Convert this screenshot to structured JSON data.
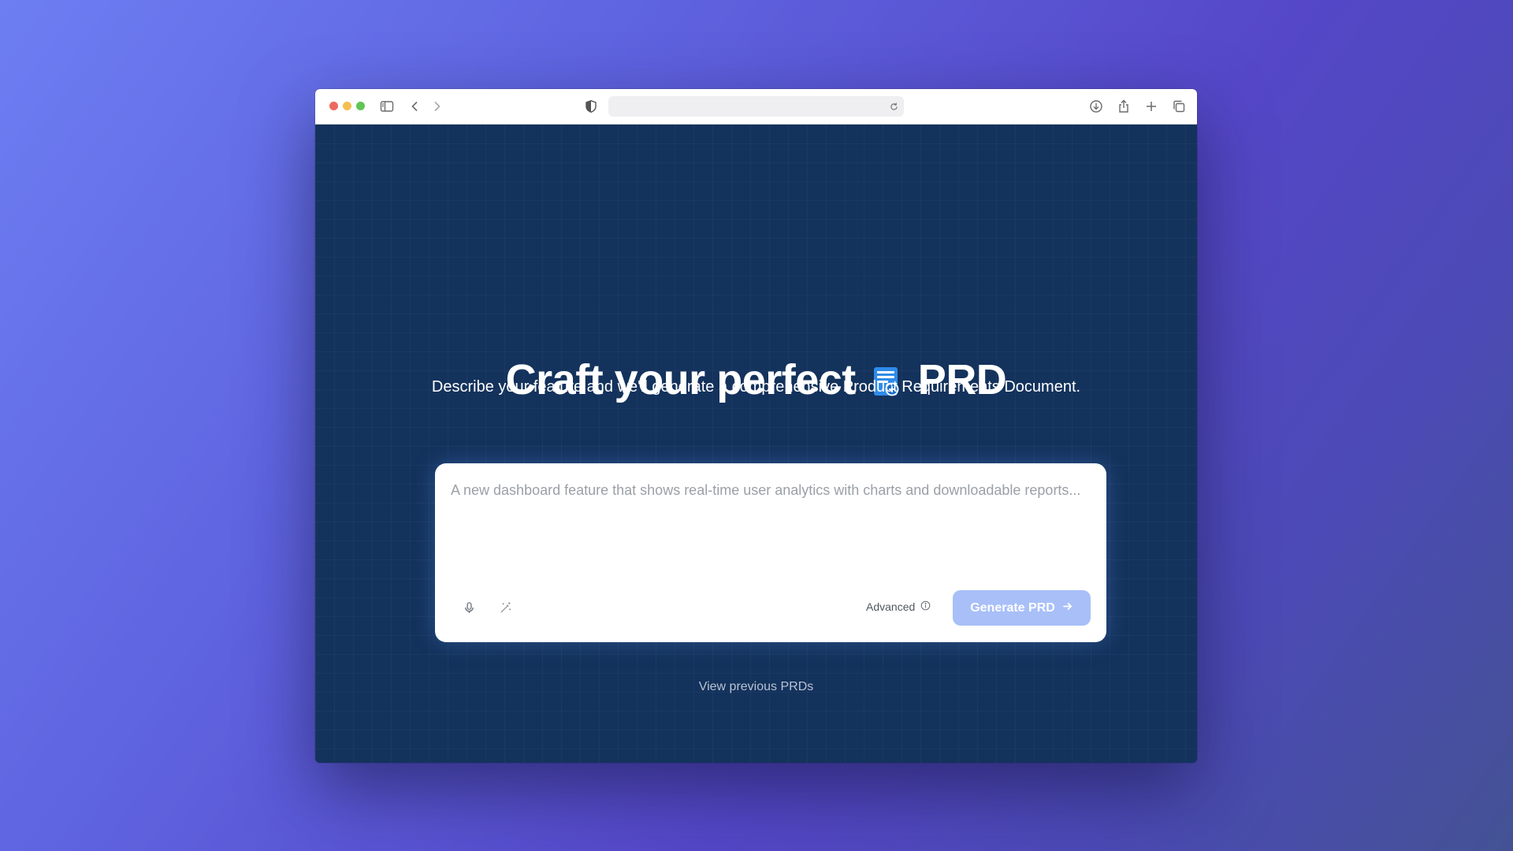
{
  "browser": {
    "url": ""
  },
  "hero": {
    "title_before": "Craft your perfect",
    "title_after": "PRD",
    "title_icon": "document-plus-icon",
    "subtitle": "Describe your feature and we'll generate a comprehensive Product Requirements Document."
  },
  "prompt": {
    "placeholder": "A new dashboard feature that shows real-time user analytics with charts and downloadable reports...",
    "value": "",
    "advanced_label": "Advanced",
    "generate_label": "Generate PRD"
  },
  "footer": {
    "view_previous_label": "View previous PRDs"
  },
  "colors": {
    "page_background": "#13325c",
    "generate_button": "#a8bff8",
    "doc_icon_blue": "#2f8be8"
  }
}
